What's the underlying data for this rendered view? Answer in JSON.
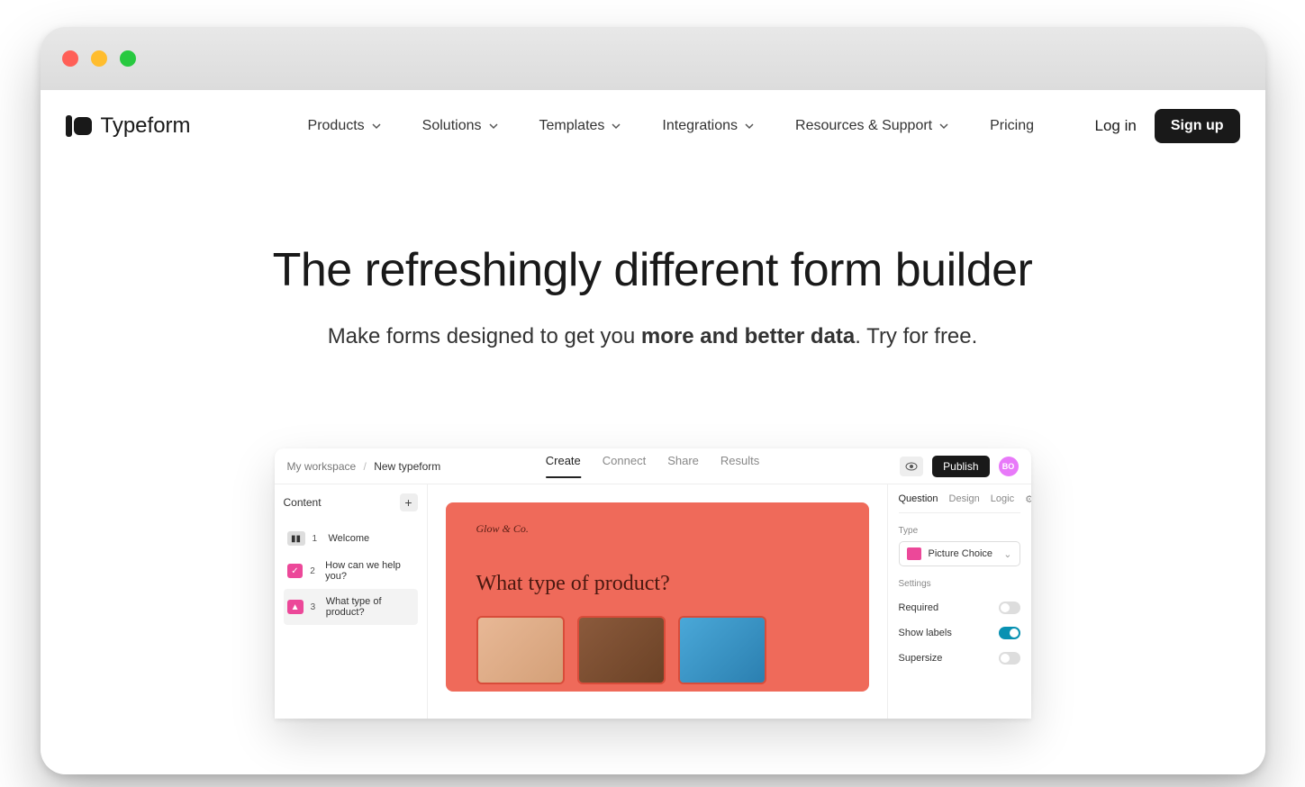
{
  "brand_name": "Typeform",
  "nav": {
    "items": [
      {
        "label": "Products"
      },
      {
        "label": "Solutions"
      },
      {
        "label": "Templates"
      },
      {
        "label": "Integrations"
      },
      {
        "label": "Resources & Support"
      },
      {
        "label": "Pricing"
      }
    ]
  },
  "auth": {
    "login": "Log in",
    "signup": "Sign up"
  },
  "hero": {
    "title": "The refreshingly different form builder",
    "subtitle_prefix": "Make forms designed to get you ",
    "subtitle_bold": "more and better data",
    "subtitle_suffix": ". Try for free."
  },
  "mock": {
    "breadcrumb": {
      "workspace": "My workspace",
      "current": "New typeform"
    },
    "tabs": [
      "Create",
      "Connect",
      "Share",
      "Results"
    ],
    "publish": "Publish",
    "avatar_initials": "BO",
    "left": {
      "heading": "Content",
      "questions": [
        {
          "num": "1",
          "label": "Welcome"
        },
        {
          "num": "2",
          "label": "How can we help you?"
        },
        {
          "num": "3",
          "label": "What type of product?"
        }
      ]
    },
    "canvas": {
      "brand": "Glow & Co.",
      "question": "What type of product?"
    },
    "right": {
      "tabs": [
        "Question",
        "Design",
        "Logic"
      ],
      "type_label": "Type",
      "type_value": "Picture Choice",
      "settings_label": "Settings",
      "settings": [
        {
          "label": "Required",
          "on": false
        },
        {
          "label": "Show labels",
          "on": true
        },
        {
          "label": "Supersize",
          "on": false
        }
      ]
    }
  }
}
